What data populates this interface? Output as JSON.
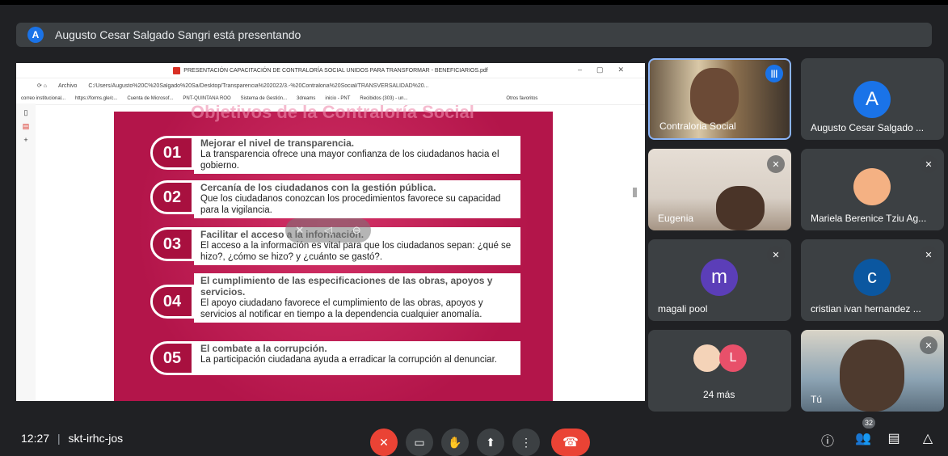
{
  "banner": {
    "avatar_letter": "A",
    "text": "Augusto Cesar Salgado Sangri está presentando"
  },
  "browser": {
    "title": "PRESENTACIÓN CAPACITACIÓN DE CONTRALORÍA SOCIAL UNIDOS PARA TRANSFORMAR - BENEFICIARIOS.pdf",
    "address_prefix": "Archivo",
    "url": "C:/Users/Augusto%20C%20Salgado%20Sa/Desktop/Transparencia%202022/3.-%20Contraloria%20Social/TRANSVERSALIDAD%20...",
    "bookmarks": [
      "correo institucional...",
      "https://forms.gle/c...",
      "Cuenta de Microsof...",
      "PNT-QUINTANA ROO",
      "Sistema de Gestión...",
      "3dreams",
      "inicio - PNT",
      "Recibidos (303) - un...",
      "Otros favoritos"
    ]
  },
  "slide": {
    "title": "Objetivos de la Contraloría Social",
    "items": [
      {
        "num": "01",
        "heading": "Mejorar el nivel de transparencia.",
        "body": "La transparencia ofrece una mayor confianza de los ciudadanos hacia el gobierno."
      },
      {
        "num": "02",
        "heading": "Cercanía de los ciudadanos con la gestión pública.",
        "body": "Que los ciudadanos conozcan los procedimientos favorece su capacidad para la vigilancia."
      },
      {
        "num": "03",
        "heading": "Facilitar el acceso a la información.",
        "body": "El acceso a la información es vital para que los ciudadanos sepan: ¿qué se hizo?, ¿cómo se hizo? y ¿cuánto se gastó?."
      },
      {
        "num": "04",
        "heading": "El cumplimiento de las especificaciones de las obras, apoyos y servicios.",
        "body": "El apoyo ciudadano favorece el cumplimiento de las obras, apoyos y servicios al notificar en tiempo a la dependencia cualquier anomalía."
      },
      {
        "num": "05",
        "heading": "El combate a la corrupción.",
        "body": "La participación ciudadana ayuda a erradicar la corrupción al denunciar."
      }
    ]
  },
  "participants": {
    "t1": {
      "name": "Contraloria Social"
    },
    "t2": {
      "name": "Augusto Cesar Salgado ...",
      "letter": "A",
      "color": "#1a73e8"
    },
    "t3": {
      "name": "Eugenia"
    },
    "t4": {
      "name": "Mariela Berenice Tziu Ag..."
    },
    "t5": {
      "name": "magali pool",
      "letter": "m",
      "color": "#5b3eb8"
    },
    "t6": {
      "name": "cristian ivan hernandez ...",
      "letter": "c",
      "color": "#0b57a0"
    },
    "t7": {
      "name": "24 más",
      "letter": "L",
      "color": "#e8506a"
    },
    "t8": {
      "name": "Tú"
    }
  },
  "bottom": {
    "time": "12:27",
    "separator": "|",
    "meeting_code": "skt-irhc-jos",
    "participant_count": "32"
  },
  "icons": {
    "mic_off": "✕",
    "camera": "▭",
    "hand": "✋",
    "present": "⬆",
    "more": "⋮",
    "hangup": "☎",
    "info": "ⓘ",
    "people": "👥",
    "chat": "▤",
    "activities": "△"
  }
}
